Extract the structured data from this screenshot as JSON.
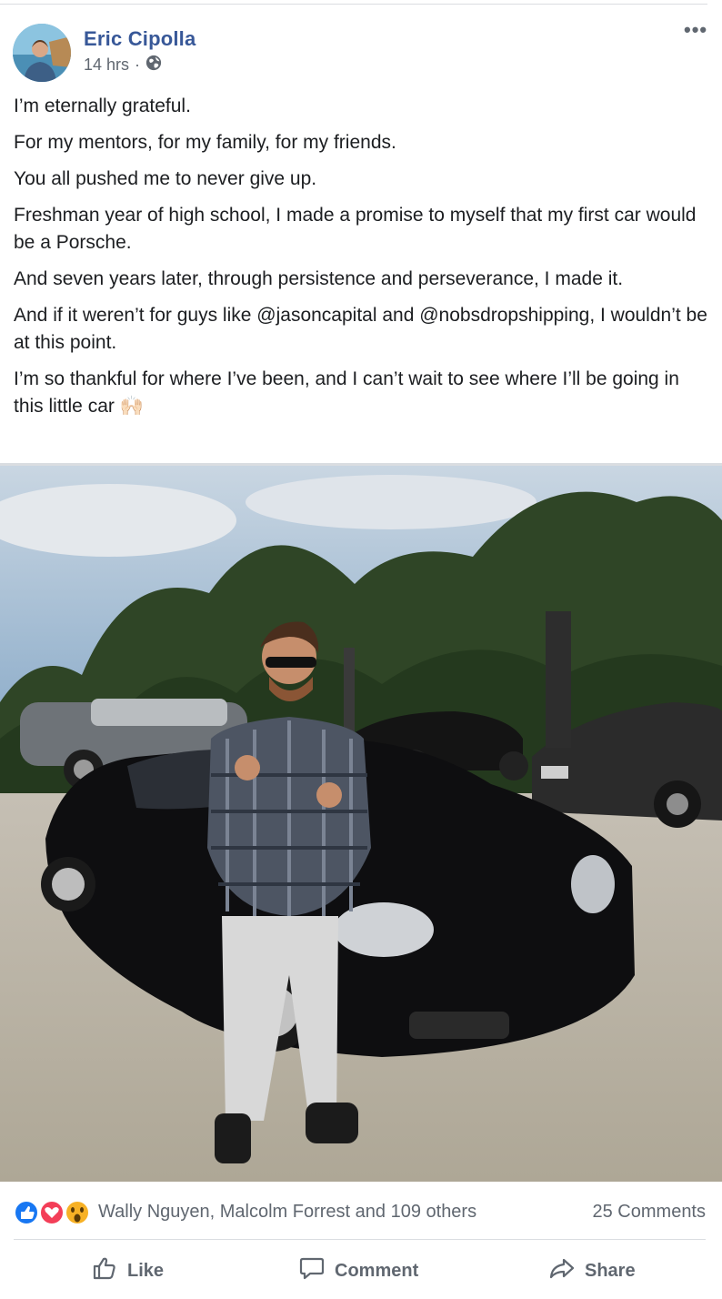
{
  "post": {
    "author": "Eric Cipolla",
    "time": "14 hrs",
    "time_separator": "·",
    "privacy_icon": "globe-icon",
    "more_options": "•••",
    "paragraphs": [
      "I’m eternally grateful.",
      "For my mentors, for my family, for my friends.",
      "You all pushed me to never give up.",
      "Freshman year of high school, I made a promise to myself that my first car would be a Porsche.",
      "And seven years later, through persistence and perseverance, I made it.",
      "And if it weren’t for guys like @jasoncapital and @nobsdropshipping, I wouldn’t be at this point.",
      "I’m so thankful for where I’ve been, and I can’t wait to see where I’ll be going in this little car"
    ],
    "emoji": "🙌🏻"
  },
  "reactions": {
    "icons": [
      "like-reaction-icon",
      "love-reaction-icon",
      "wow-reaction-icon"
    ],
    "summary": "Wally Nguyen, Malcolm Forrest and 109 others",
    "comments": "25 Comments"
  },
  "actions": {
    "like": "Like",
    "comment": "Comment",
    "share": "Share"
  },
  "colors": {
    "author_link": "#385898",
    "secondary_text": "#606770",
    "like_blue": "#1877f2",
    "love_red": "#f33e58",
    "wow_yellow": "#f7b125"
  }
}
